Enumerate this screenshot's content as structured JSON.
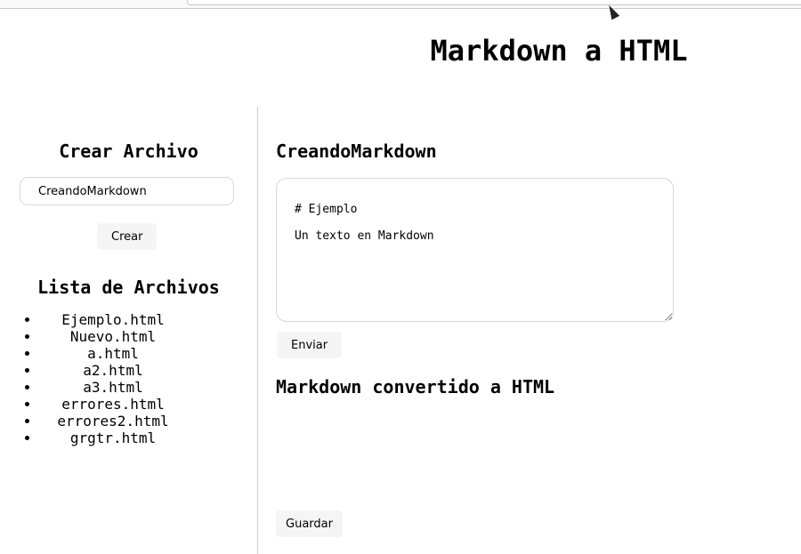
{
  "page": {
    "title": "Markdown a HTML"
  },
  "sidebar": {
    "create_heading": "Crear Archivo",
    "file_name_value": "CreandoMarkdown",
    "create_button": "Crear",
    "list_heading": "Lista de Archivos",
    "files": [
      "Ejemplo.html",
      "Nuevo.html",
      "a.html",
      "a2.html",
      "a3.html",
      "errores.html",
      "errores2.html",
      "grgtr.html"
    ]
  },
  "editor": {
    "file_heading": "CreandoMarkdown",
    "content": "# Ejemplo\nUn texto en Markdown",
    "send_button": "Enviar",
    "output_heading": "Markdown convertido a HTML",
    "save_button": "Guardar"
  }
}
